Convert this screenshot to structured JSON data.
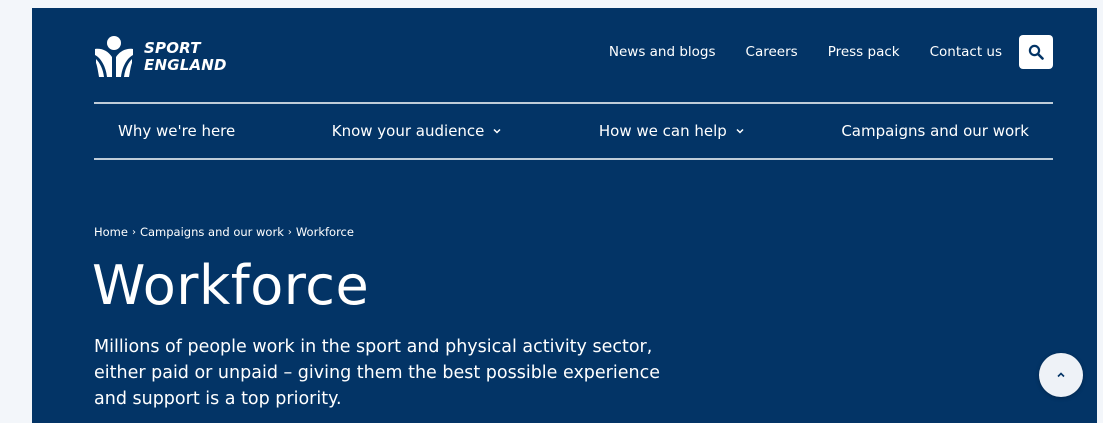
{
  "brand": {
    "line1": "SPORT",
    "line2": "ENGLAND"
  },
  "utility_nav": [
    {
      "label": "News and blogs"
    },
    {
      "label": "Careers"
    },
    {
      "label": "Press pack"
    },
    {
      "label": "Contact us"
    }
  ],
  "main_nav": [
    {
      "label": "Why we're here",
      "has_dropdown": false
    },
    {
      "label": "Know your audience",
      "has_dropdown": true
    },
    {
      "label": "How we can help",
      "has_dropdown": true
    },
    {
      "label": "Campaigns and our work",
      "has_dropdown": false
    }
  ],
  "breadcrumb": [
    {
      "label": "Home"
    },
    {
      "label": "Campaigns and our work"
    },
    {
      "label": "Workforce"
    }
  ],
  "breadcrumb_separator": "›",
  "page": {
    "title": "Workforce",
    "intro_lines": [
      "Millions of people work in the sport and physical activity sector,",
      "either paid or unpaid – giving them the best possible experience",
      "and support is a top priority."
    ]
  },
  "icons": {
    "search": "search-icon",
    "chevron": "chevron-down-icon",
    "back_to_top": "chevron-up-icon"
  },
  "colors": {
    "background": "#033466",
    "text": "#ffffff",
    "outer": "#f3f6fa"
  }
}
